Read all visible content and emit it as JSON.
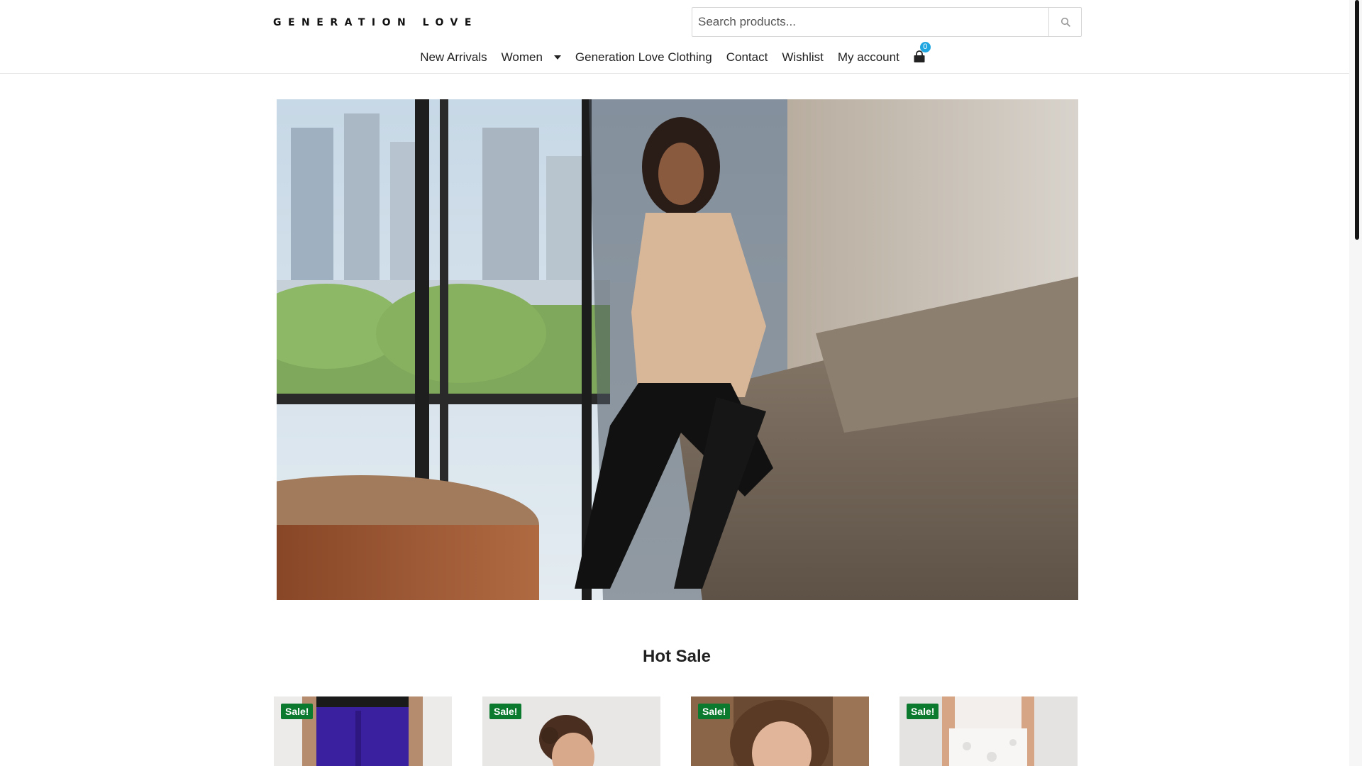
{
  "header": {
    "logo_text": "GENERATION LOVE",
    "search": {
      "placeholder": "Search products..."
    }
  },
  "nav": {
    "items": [
      {
        "label": "New Arrivals"
      },
      {
        "label": "Women"
      },
      {
        "label": "Generation Love Clothing"
      },
      {
        "label": "Contact"
      },
      {
        "label": "Wishlist"
      },
      {
        "label": "My account"
      }
    ],
    "cart_count": "0"
  },
  "hot_sale": {
    "title": "Hot Sale",
    "products": [
      {
        "badge": "Sale!"
      },
      {
        "badge": "Sale!"
      },
      {
        "badge": "Sale!"
      },
      {
        "badge": "Sale!"
      }
    ]
  },
  "icons": {
    "search": "search-icon",
    "cart": "shopping-bag-icon",
    "dropdown": "chevron-down-icon"
  },
  "colors": {
    "sale_badge": "#0b7a2f",
    "cart_badge": "#1fa6e0"
  }
}
